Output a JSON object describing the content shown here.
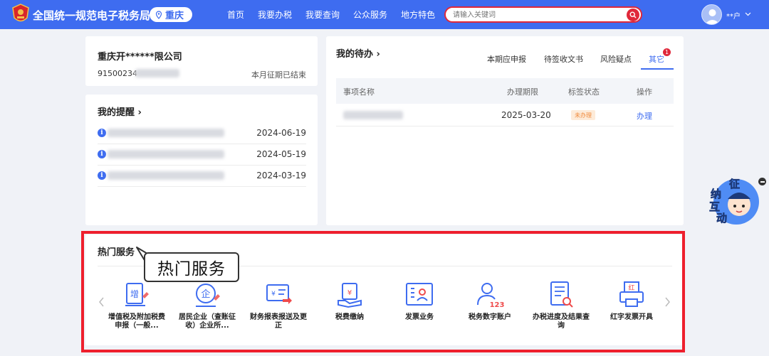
{
  "header": {
    "site_title": "全国统一规范电子税务局",
    "city": "重庆",
    "nav": [
      "首页",
      "我要办税",
      "我要查询",
      "公众服务",
      "地方特色"
    ],
    "search_placeholder": "请输入关键词",
    "user_name": "**户"
  },
  "company": {
    "name": "重庆开******限公司",
    "tax_id_visible": "91500234",
    "period_status": "本月征期已结束"
  },
  "reminders": {
    "title": "我的提醒 ›",
    "items": [
      {
        "date": "2024-06-19"
      },
      {
        "date": "2024-05-19"
      },
      {
        "date": "2024-03-19"
      }
    ]
  },
  "todo": {
    "title": "我的待办 ›",
    "tabs": [
      "本期应申报",
      "待签收文书",
      "风险疑点",
      "其它"
    ],
    "active_tab": "其它",
    "badge": "1",
    "columns": [
      "事项名称",
      "办理期限",
      "标签状态",
      "操作"
    ],
    "rows": [
      {
        "deadline": "2025-03-20",
        "status": "未办理",
        "action": "办理"
      }
    ]
  },
  "hot": {
    "title": "热门服务",
    "callout": "热门服务",
    "services": [
      {
        "label": "增值税及附加税费申报（一般...",
        "icon": "vat-icon"
      },
      {
        "label": "居民企业（查账征收）企业所...",
        "icon": "enterprise-icon"
      },
      {
        "label": "财务报表报送及更正",
        "icon": "report-icon"
      },
      {
        "label": "税费缴纳",
        "icon": "payment-icon"
      },
      {
        "label": "发票业务",
        "icon": "invoice-icon"
      },
      {
        "label": "税务数字账户",
        "icon": "account-icon"
      },
      {
        "label": "办税进度及结果查询",
        "icon": "query-icon"
      },
      {
        "label": "红字发票开具",
        "icon": "red-invoice-icon"
      }
    ]
  },
  "widget": {
    "chars": [
      "征",
      "纳",
      "互",
      "动"
    ]
  },
  "colors": {
    "primary": "#3e6cf0",
    "highlight": "#ee1f2d",
    "background": "#f0f2f7"
  }
}
